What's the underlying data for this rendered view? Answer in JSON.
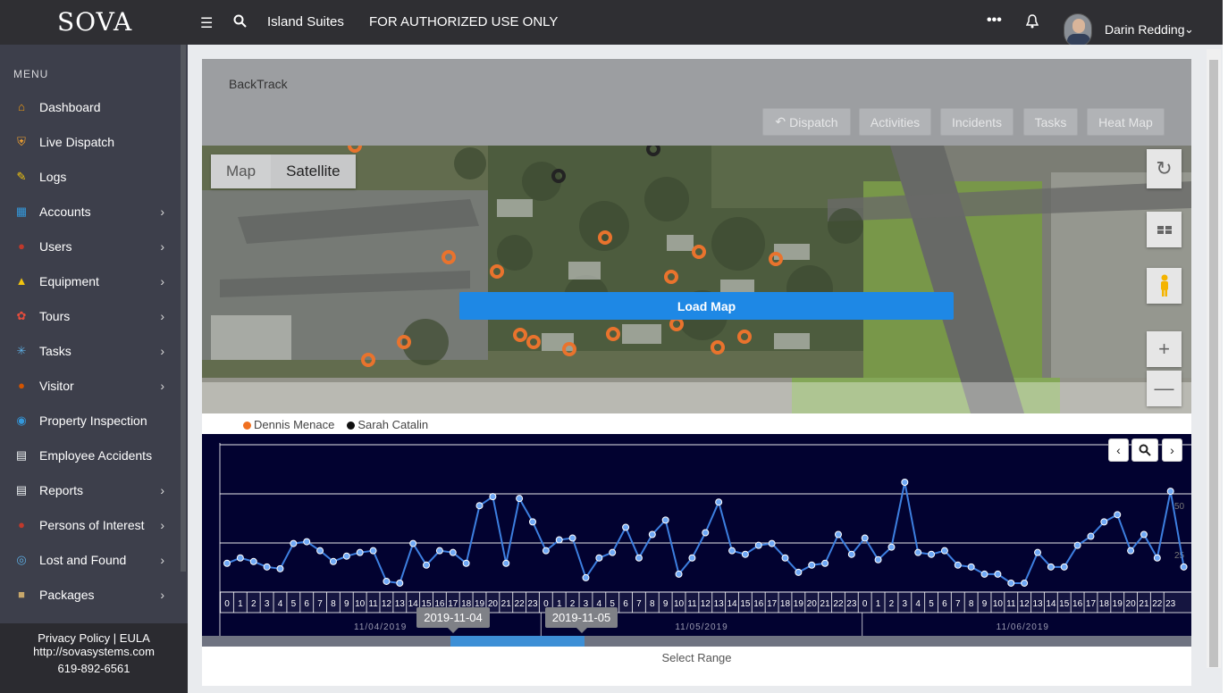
{
  "topbar": {
    "logo": "SOVA",
    "property": "Island Suites",
    "banner": "FOR AUTHORIZED USE ONLY",
    "more_icon": "ellipsis-icon",
    "bell_icon": "bell-icon",
    "user_name": "Darin Redding"
  },
  "sidebar": {
    "menu_title": "MENU",
    "items": [
      {
        "label": "Dashboard",
        "icon": "home-icon",
        "color": "#f39c12",
        "arrow": false
      },
      {
        "label": "Live Dispatch",
        "icon": "shield-icon",
        "color": "#f0a030",
        "arrow": false
      },
      {
        "label": "Logs",
        "icon": "pencil-icon",
        "color": "#f1c40f",
        "arrow": false
      },
      {
        "label": "Accounts",
        "icon": "building-icon",
        "color": "#3498db",
        "arrow": true
      },
      {
        "label": "Users",
        "icon": "person-icon",
        "color": "#c0392b",
        "arrow": true
      },
      {
        "label": "Equipment",
        "icon": "hardhat-icon",
        "color": "#f1c40f",
        "arrow": true
      },
      {
        "label": "Tours",
        "icon": "compass-icon",
        "color": "#e74c3c",
        "arrow": true
      },
      {
        "label": "Tasks",
        "icon": "network-icon",
        "color": "#5dade2",
        "arrow": true
      },
      {
        "label": "Visitor",
        "icon": "visitor-icon",
        "color": "#d35400",
        "arrow": true
      },
      {
        "label": "Property Inspection",
        "icon": "inspection-icon",
        "color": "#3498db",
        "arrow": false
      },
      {
        "label": "Employee Accidents",
        "icon": "clipboard-icon",
        "color": "#ecf0f1",
        "arrow": false
      },
      {
        "label": "Reports",
        "icon": "report-icon",
        "color": "#ecf0f1",
        "arrow": true
      },
      {
        "label": "Persons of Interest",
        "icon": "poi-icon",
        "color": "#c0392b",
        "arrow": true
      },
      {
        "label": "Lost and Found",
        "icon": "target-icon",
        "color": "#5dade2",
        "arrow": true
      },
      {
        "label": "Packages",
        "icon": "package-icon",
        "color": "#c8a86b",
        "arrow": true
      }
    ],
    "footer": {
      "links": "Privacy Policy | EULA",
      "url": "http://sovasystems.com",
      "phone": "619-892-6561"
    }
  },
  "backtrack": {
    "title": "BackTrack",
    "tabs": [
      "Dispatch",
      "Activities",
      "Incidents",
      "Tasks",
      "Heat Map"
    ]
  },
  "map": {
    "type_options": [
      "Map",
      "Satellite"
    ],
    "selected_type": "Satellite",
    "load_button": "Load Map",
    "controls": [
      "rotate-icon",
      "tilt-icon",
      "pegman-icon",
      "zoom-in-icon",
      "zoom-out-icon"
    ]
  },
  "legend": [
    {
      "name": "Dennis Menace",
      "color": "#f07020"
    },
    {
      "name": "Sarah Catalin",
      "color": "#111111"
    }
  ],
  "colors": {
    "accent": "#1e88e5",
    "chart_bg": "#020230",
    "chart_line": "#3d7fe0",
    "orange_marker": "#e8681c"
  },
  "chart_data": {
    "type": "line",
    "ytick_labels": [
      "50",
      "25"
    ],
    "values": [
      12,
      15,
      13,
      10,
      9,
      23,
      24,
      19,
      13,
      16,
      18,
      19,
      2,
      1,
      23,
      11,
      19,
      18,
      12,
      44,
      49,
      12,
      48,
      35,
      19,
      25,
      26,
      4,
      15,
      18,
      32,
      15,
      28,
      36,
      6,
      15,
      29,
      46,
      19,
      17,
      22,
      23,
      15,
      7,
      11,
      12,
      28,
      17,
      26,
      14,
      21,
      57,
      18,
      17,
      19,
      11,
      10,
      6,
      6,
      1,
      1,
      18,
      10,
      10,
      22,
      27,
      35,
      39,
      19,
      28,
      15,
      52,
      10
    ],
    "hour_labels": [
      "0",
      "1",
      "2",
      "3",
      "4",
      "5",
      "6",
      "7",
      "8",
      "9",
      "10",
      "11",
      "12",
      "13",
      "14",
      "15",
      "16",
      "17",
      "18",
      "19",
      "20",
      "21",
      "22",
      "23",
      "0",
      "1",
      "2",
      "3",
      "4",
      "5",
      "6",
      "7",
      "8",
      "9",
      "10",
      "11",
      "12",
      "13",
      "14",
      "15",
      "16",
      "17",
      "18",
      "19",
      "20",
      "21",
      "22",
      "23",
      "0",
      "1",
      "2",
      "3",
      "4",
      "5",
      "6",
      "7",
      "8",
      "9",
      "10",
      "11",
      "12",
      "13",
      "14",
      "15",
      "16",
      "17",
      "18",
      "19",
      "20",
      "21",
      "22",
      "23"
    ],
    "day_labels": [
      "11/04/2019",
      "11/05/2019",
      "11/06/2019"
    ],
    "nav": [
      "prev-icon",
      "search-icon",
      "next-icon"
    ]
  },
  "range": {
    "start": "2019-11-04",
    "end": "2019-11-05",
    "caption": "Select Range"
  }
}
